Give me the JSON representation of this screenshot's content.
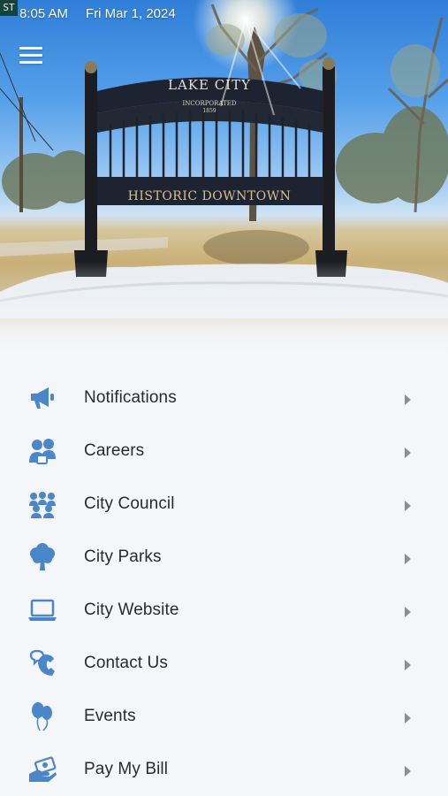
{
  "status_bar": {
    "badge": "ST",
    "time": "8:05 AM",
    "date": "Fri Mar 1, 2024"
  },
  "hero": {
    "sign_top": "LAKE CITY",
    "sign_incorporated": "INCORPORATED",
    "sign_year": "1859",
    "sign_bottom": "HISTORIC DOWNTOWN"
  },
  "menu": {
    "items": [
      {
        "label": "Notifications",
        "icon": "megaphone-icon"
      },
      {
        "label": "Careers",
        "icon": "people-briefcase-icon"
      },
      {
        "label": "City Council",
        "icon": "group-icon"
      },
      {
        "label": "City Parks",
        "icon": "tree-icon"
      },
      {
        "label": "City Website",
        "icon": "laptop-icon"
      },
      {
        "label": "Contact Us",
        "icon": "phone-chat-icon"
      },
      {
        "label": "Events",
        "icon": "balloons-icon"
      },
      {
        "label": "Pay My Bill",
        "icon": "money-hand-icon"
      }
    ]
  },
  "colors": {
    "icon_blue": "#4a86c8",
    "label_text": "#2b2b2b",
    "chevron": "#8c8c8c",
    "list_background": "#f4f6f9"
  }
}
